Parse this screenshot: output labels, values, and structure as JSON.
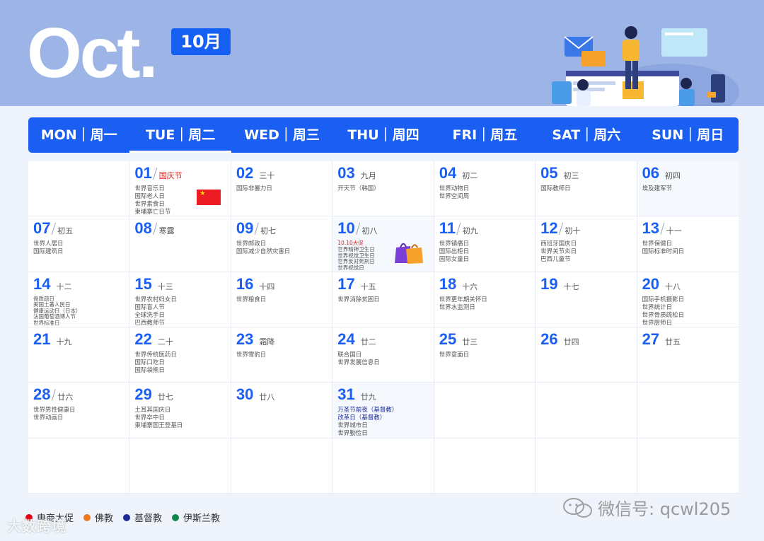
{
  "header": {
    "month_en": "Oct.",
    "month_cn": "10月"
  },
  "weekdays": [
    "MON｜周一",
    "TUE｜周二",
    "WED｜周三",
    "THU｜周四",
    "FRI｜周五",
    "SAT｜周六",
    "SUN｜周日"
  ],
  "days": [
    {
      "num": "01",
      "lunar": "国庆节",
      "slash": true,
      "red": true,
      "events": [
        "世界音乐日",
        "国际老人日",
        "世界素食日",
        "柬埔寨亡日节"
      ]
    },
    {
      "num": "02",
      "lunar": "三十",
      "events": [
        "国际非暴力日"
      ]
    },
    {
      "num": "03",
      "lunar": "九月",
      "events": [
        "开天节（韩国）"
      ]
    },
    {
      "num": "04",
      "lunar": "初二",
      "events": [
        "世界动物日",
        "世界空间周"
      ]
    },
    {
      "num": "05",
      "lunar": "初三",
      "events": [
        "国际教师日"
      ]
    },
    {
      "num": "06",
      "lunar": "初四",
      "events": [
        "埃及建军节"
      ]
    },
    {
      "num": "07",
      "lunar": "初五",
      "slash": true,
      "events": [
        "世界人居日",
        "国际建筑日"
      ]
    },
    {
      "num": "08",
      "lunar": "寒露",
      "slash": true,
      "events": []
    },
    {
      "num": "09",
      "lunar": "初七",
      "slash": true,
      "events": [
        "世界邮政日",
        "国际减少自然灾害日"
      ]
    },
    {
      "num": "10",
      "lunar": "初八",
      "slash": true,
      "events": [
        "10.10大促",
        "世界精神卫生日",
        "世界视觉卫生日",
        "世界反对死刑日",
        "世界视觉日"
      ]
    },
    {
      "num": "11",
      "lunar": "初九",
      "slash": true,
      "events": [
        "世界镇痛日",
        "国际出柜日",
        "国际女童日"
      ]
    },
    {
      "num": "12",
      "lunar": "初十",
      "slash": true,
      "events": [
        "西班牙国庆日",
        "世界关节炎日",
        "巴西儿童节"
      ]
    },
    {
      "num": "13",
      "lunar": "十一",
      "slash": true,
      "events": [
        "世界保健日",
        "国际标准时间日"
      ]
    },
    {
      "num": "14",
      "lunar": "十二",
      "events": [
        "骨质疏日",
        "美国土著人民日",
        "健康运动日（日本）",
        "法国葡萄酒博人节",
        "世界标准日"
      ]
    },
    {
      "num": "15",
      "lunar": "十三",
      "events": [
        "世界农村妇女日",
        "国际盲人节",
        "全球洗手日",
        "巴西教师节"
      ]
    },
    {
      "num": "16",
      "lunar": "十四",
      "events": [
        "世界粮食日"
      ]
    },
    {
      "num": "17",
      "lunar": "十五",
      "events": [
        "世界消除贫困日"
      ]
    },
    {
      "num": "18",
      "lunar": "十六",
      "events": [
        "世界更年期关怀日",
        "世界水监测日"
      ]
    },
    {
      "num": "19",
      "lunar": "十七",
      "events": []
    },
    {
      "num": "20",
      "lunar": "十八",
      "events": [
        "国际手机摄影日",
        "世界统计日",
        "世界骨质疏松日",
        "世界厨师日"
      ]
    },
    {
      "num": "21",
      "lunar": "十九",
      "events": []
    },
    {
      "num": "22",
      "lunar": "二十",
      "events": [
        "世界传统医药日",
        "国际口吃日",
        "国际袋熊日"
      ]
    },
    {
      "num": "23",
      "lunar": "霜降",
      "events": [
        "世界雪豹日"
      ]
    },
    {
      "num": "24",
      "lunar": "廿二",
      "events": [
        "联合国日",
        "世界发展信息日"
      ]
    },
    {
      "num": "25",
      "lunar": "廿三",
      "events": [
        "世界意面日"
      ]
    },
    {
      "num": "26",
      "lunar": "廿四",
      "events": []
    },
    {
      "num": "27",
      "lunar": "廿五",
      "events": []
    },
    {
      "num": "28",
      "lunar": "廿六",
      "slash": true,
      "events": [
        "世界男性健康日",
        "世界动画日"
      ]
    },
    {
      "num": "29",
      "lunar": "廿七",
      "events": [
        "土耳其国庆日",
        "世界卒中日",
        "柬埔寨国王登基日"
      ]
    },
    {
      "num": "30",
      "lunar": "廿八",
      "events": []
    },
    {
      "num": "31",
      "lunar": "廿九",
      "events": [
        "万圣节前夜（基督教）",
        "改革日（基督教）",
        "世界城市日",
        "世界勤俭日"
      ]
    }
  ],
  "legend": [
    {
      "label": "电商大促",
      "color": "#e60012"
    },
    {
      "label": "佛教",
      "color": "#f07a20"
    },
    {
      "label": "基督教",
      "color": "#1b2b9a"
    },
    {
      "label": "伊斯兰教",
      "color": "#12884a"
    }
  ],
  "watermark_left": "大数跨境",
  "watermark_right": "微信号: qcwl205"
}
